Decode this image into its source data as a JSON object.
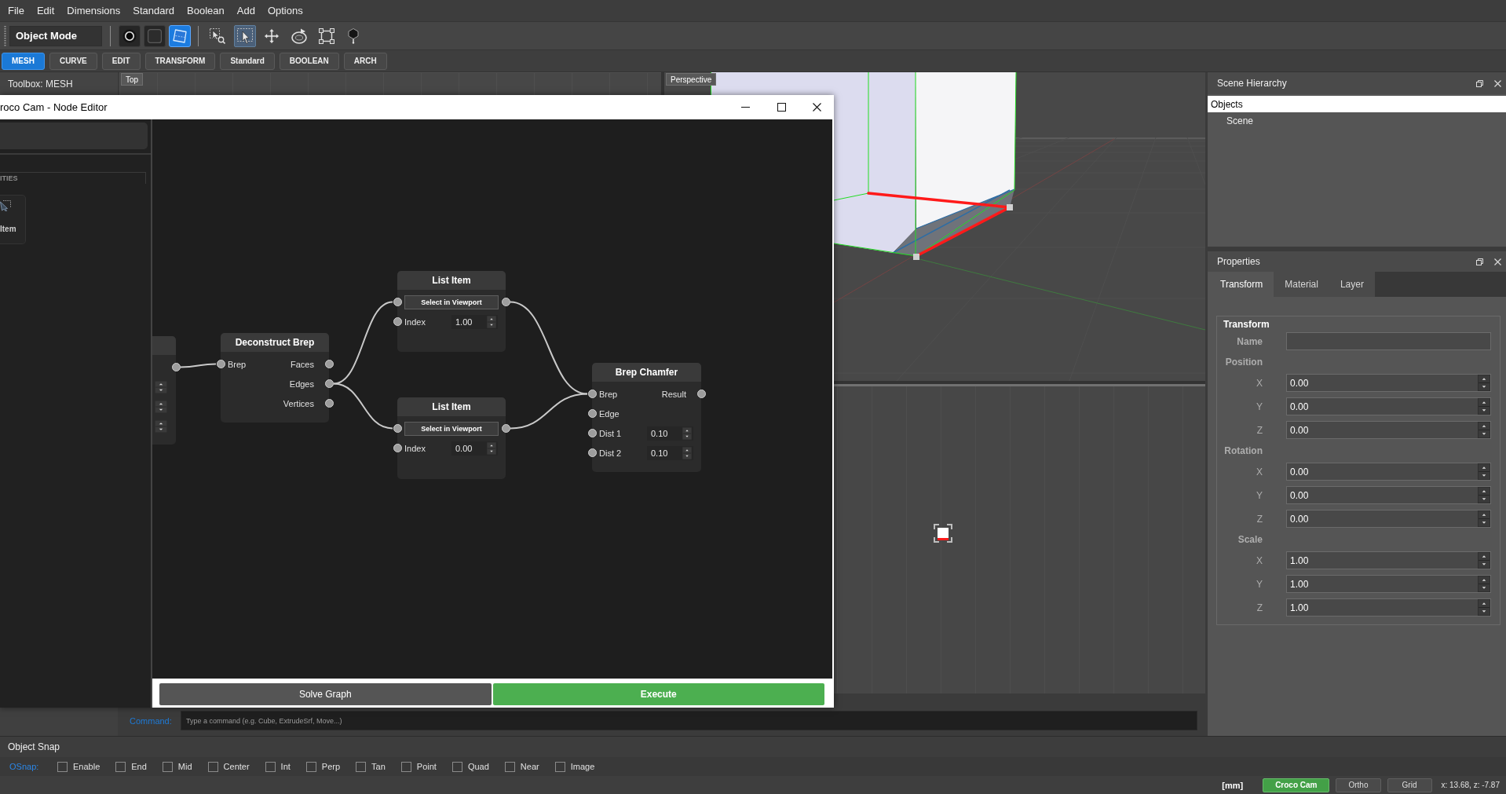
{
  "menu": [
    "File",
    "Edit",
    "Dimensions",
    "Standard",
    "Boolean",
    "Add",
    "Options"
  ],
  "toolbar": {
    "mode": "Object Mode",
    "view_modes": [
      {
        "selected": false
      },
      {
        "selected": false
      },
      {
        "selected": true
      }
    ],
    "tools": [
      {
        "selected": false
      },
      {
        "selected": true
      },
      {
        "selected": false
      },
      {
        "selected": false
      },
      {
        "selected": false
      },
      {
        "selected": false
      }
    ]
  },
  "ribbon_tabs": [
    {
      "label": "MESH",
      "selected": true
    },
    {
      "label": "CURVE",
      "selected": false
    },
    {
      "label": "EDIT",
      "selected": false
    },
    {
      "label": "TRANSFORM",
      "selected": false
    },
    {
      "label": "Standard",
      "selected": false
    },
    {
      "label": "BOOLEAN",
      "selected": false
    },
    {
      "label": "ARCH",
      "selected": false
    }
  ],
  "toolbox": {
    "title": "Toolbox: MESH"
  },
  "viewports": [
    {
      "label": "Top"
    },
    {
      "label": "Perspective"
    }
  ],
  "node_editor": {
    "title": "roco Cam - Node Editor",
    "sidebar": {
      "section": "ITIES",
      "items": [
        {
          "label": "Item"
        }
      ]
    },
    "nodes": [
      {
        "rows": [
          {
            "kind": "output"
          },
          {
            "kind": "spinner"
          },
          {
            "kind": "spinner"
          },
          {
            "kind": "spinner"
          }
        ]
      },
      {
        "title": "Deconstruct Brep",
        "rows": [
          {
            "kind": "port",
            "label": "Brep",
            "output": "Faces"
          },
          {
            "kind": "output",
            "output": "Edges"
          },
          {
            "kind": "output",
            "output": "Vertices"
          }
        ]
      },
      {
        "title": "List Item",
        "rows": [
          {
            "kind": "button",
            "label": "Select in Viewport"
          },
          {
            "kind": "number",
            "label": "Index",
            "value": "1.00"
          }
        ]
      },
      {
        "title": "List Item",
        "rows": [
          {
            "kind": "button",
            "label": "Select in Viewport"
          },
          {
            "kind": "number",
            "label": "Index",
            "value": "0.00"
          }
        ]
      },
      {
        "title": "Brep Chamfer",
        "rows": [
          {
            "kind": "port",
            "label": "Brep",
            "output": "Result"
          },
          {
            "kind": "port",
            "label": "Edge"
          },
          {
            "kind": "number",
            "label": "Dist 1",
            "value": "0.10"
          },
          {
            "kind": "number",
            "label": "Dist 2",
            "value": "0.10"
          }
        ]
      }
    ],
    "buttons": [
      {
        "label": "Solve Graph",
        "kind": "secondary"
      },
      {
        "label": "Execute",
        "kind": "primary"
      }
    ]
  },
  "command": {
    "label": "Command:",
    "placeholder": "Type a command (e.g. Cube, ExtrudeSrf, Move...)"
  },
  "scene_hierarchy": {
    "title": "Scene Hierarchy",
    "tree": [
      {
        "label": "Objects",
        "selected": true,
        "children": [
          {
            "label": "Scene",
            "selected": false
          }
        ]
      }
    ]
  },
  "properties": {
    "title": "Properties",
    "tabs": [
      {
        "label": "Transform",
        "selected": true
      },
      {
        "label": "Material",
        "selected": false
      },
      {
        "label": "Layer",
        "selected": false
      }
    ],
    "group": {
      "title": "Transform",
      "name_label": "Name",
      "sections": [
        {
          "title": "Position",
          "fields": [
            {
              "label": "X",
              "value": "0.00"
            },
            {
              "label": "Y",
              "value": "0.00"
            },
            {
              "label": "Z",
              "value": "0.00"
            }
          ]
        },
        {
          "title": "Rotation",
          "fields": [
            {
              "label": "X",
              "value": "0.00"
            },
            {
              "label": "Y",
              "value": "0.00"
            },
            {
              "label": "Z",
              "value": "0.00"
            }
          ]
        },
        {
          "title": "Scale",
          "fields": [
            {
              "label": "X",
              "value": "1.00"
            },
            {
              "label": "Y",
              "value": "1.00"
            },
            {
              "label": "Z",
              "value": "1.00"
            }
          ]
        }
      ]
    }
  },
  "object_snap": {
    "title": "Object Snap",
    "label": "OSnap:",
    "options": [
      {
        "label": "Enable",
        "checked": false
      },
      {
        "label": "End",
        "checked": false
      },
      {
        "label": "Mid",
        "checked": false
      },
      {
        "label": "Center",
        "checked": false
      },
      {
        "label": "Int",
        "checked": false
      },
      {
        "label": "Perp",
        "checked": false
      },
      {
        "label": "Tan",
        "checked": false
      },
      {
        "label": "Point",
        "checked": false
      },
      {
        "label": "Quad",
        "checked": false
      },
      {
        "label": "Near",
        "checked": false
      },
      {
        "label": "Image",
        "checked": false
      }
    ]
  },
  "status_bar": {
    "units": "[mm]",
    "toggles": [
      {
        "label": "Croco Cam",
        "on": true
      },
      {
        "label": "Ortho",
        "on": false
      },
      {
        "label": "Grid",
        "on": false
      }
    ],
    "coordinates": "x: 13.68, z: -7.87"
  }
}
